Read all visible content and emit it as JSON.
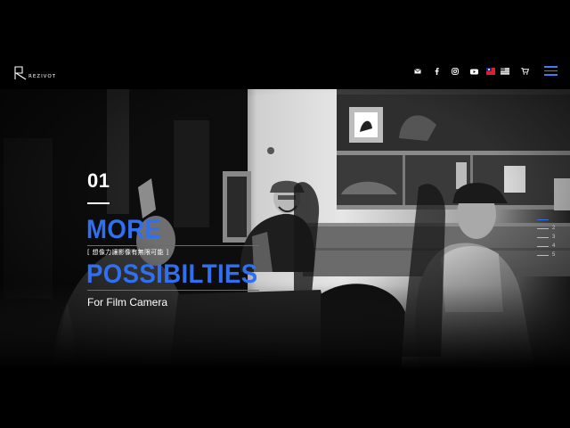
{
  "brand": {
    "name": "REZIVOT"
  },
  "header": {
    "social": [
      {
        "name": "mail-icon"
      },
      {
        "name": "facebook-icon"
      },
      {
        "name": "instagram-icon"
      },
      {
        "name": "youtube-icon"
      }
    ],
    "languages": [
      {
        "name": "taiwan-flag-icon",
        "label": "繁中"
      },
      {
        "name": "us-flag-icon",
        "label": "EN"
      }
    ],
    "cart_icon": "cart-icon",
    "menu_icon": "hamburger-menu-icon",
    "accent_color": "#2f6ff0"
  },
  "hero": {
    "slide_number": "01",
    "title_line_1": "MORE",
    "subtitle_tag": "[ 想像力讓影像有無限可能 ]",
    "title_line_2": "POSSIBILTIES",
    "tagline": "For Film Camera"
  },
  "pager": {
    "active_index": 0,
    "items": [
      "1",
      "2",
      "3",
      "4",
      "5"
    ]
  }
}
